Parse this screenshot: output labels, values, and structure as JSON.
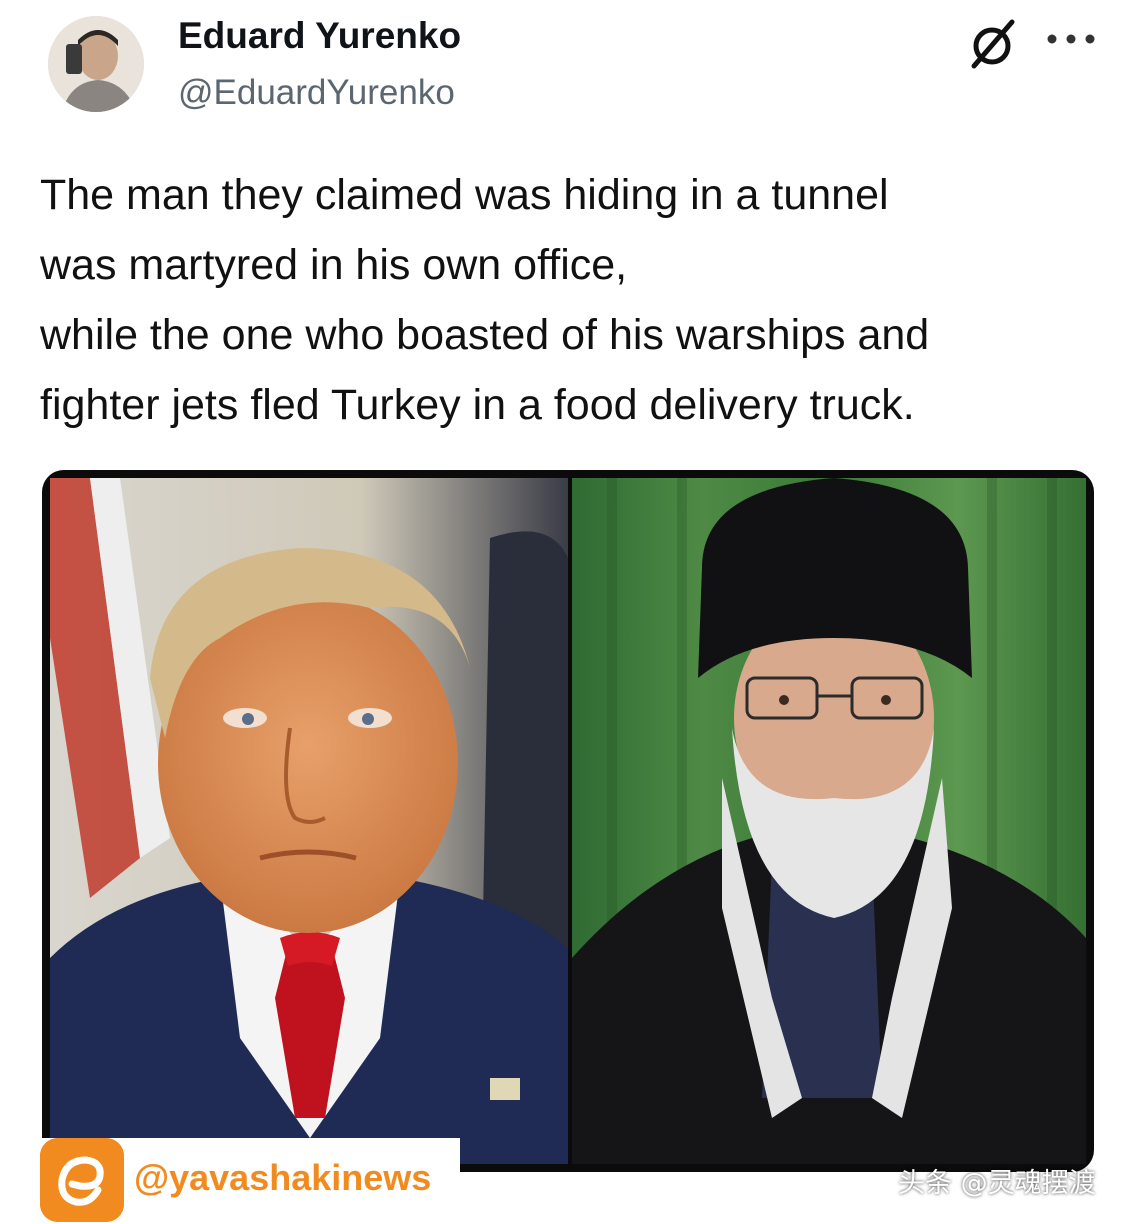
{
  "author": {
    "display_name": "Eduard Yurenko",
    "handle": "@EduardYurenko"
  },
  "header_icons": {
    "grok": "grok-icon",
    "more": "more-options-icon"
  },
  "tweet": {
    "lines": [
      "The man they claimed was hiding in a tunnel",
      "was martyred in his own office,",
      "while the one who boasted of his warships and",
      "fighter jets fled Turkey in a food delivery truck."
    ]
  },
  "media": {
    "left_photo": "portrait-left",
    "right_photo": "portrait-right"
  },
  "watermark": {
    "text": "@yavashakinews",
    "color": "#f28b1f"
  },
  "source_mark": {
    "text": "头条 @灵魂摆渡"
  }
}
